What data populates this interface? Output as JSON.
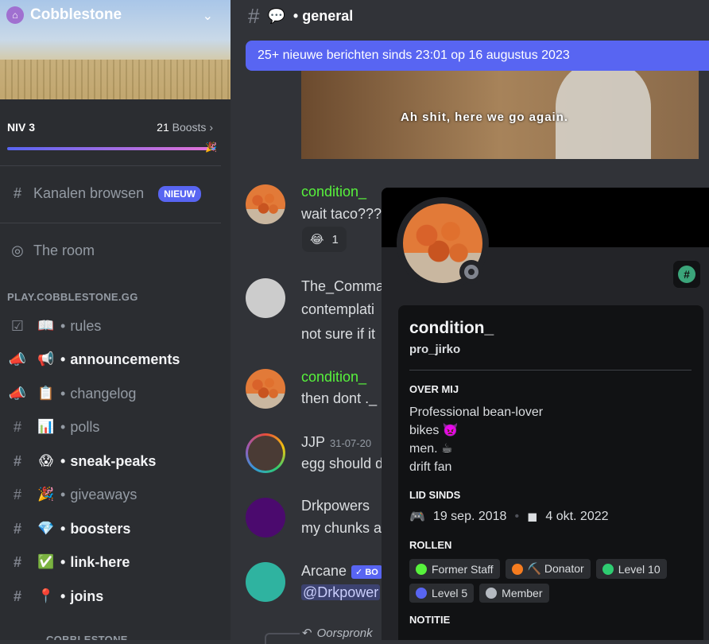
{
  "server": {
    "name": "Cobblestone",
    "level": "NIV 3",
    "boost_count": "21",
    "boost_label": "Boosts",
    "browse_label": "Kanalen browsen",
    "new_badge": "NIEUW",
    "stage": "The room",
    "category": "PLAY.COBBLESTONE.GG",
    "category2": "COBBLESTONE"
  },
  "channels": [
    {
      "icon": "checkbox-icon",
      "emoji": "📖",
      "name": "rules",
      "unread": false
    },
    {
      "icon": "megaphone-icon",
      "emoji": "📢",
      "name": "announcements",
      "unread": true
    },
    {
      "icon": "megaphone-icon",
      "emoji": "📋",
      "name": "changelog",
      "unread": false
    },
    {
      "icon": "hash-icon",
      "emoji": "📊",
      "name": "polls",
      "unread": false
    },
    {
      "icon": "hash-icon",
      "emoji": "😱",
      "name": "sneak-peaks",
      "unread": true
    },
    {
      "icon": "hash-icon",
      "emoji": "🎉",
      "name": "giveaways",
      "unread": false
    },
    {
      "icon": "hash-icon",
      "emoji": "💎",
      "name": "boosters",
      "unread": true
    },
    {
      "icon": "hash-icon",
      "emoji": "✅",
      "name": "link-here",
      "unread": true
    },
    {
      "icon": "hash-icon",
      "emoji": "📍",
      "name": "joins",
      "unread": true
    }
  ],
  "chat": {
    "channel": "general",
    "new_messages_banner": "25+ nieuwe berichten sinds 23:01 op 16 augustus 2023",
    "video_caption": "Ah shit, here we go again.",
    "messages": [
      {
        "author": "condition_",
        "text": "wait taco???"
      },
      {
        "author": "The_Comma",
        "text": "contemplati",
        "text2": "not sure if it"
      },
      {
        "author": "condition_",
        "text": "then dont ._"
      },
      {
        "author": "JJP",
        "time": "31-07-20",
        "text": "egg should d"
      },
      {
        "author": "Drkpowers",
        "text": "my chunks a"
      },
      {
        "author": "Arcane",
        "tag": "BO",
        "text": "@Drkpower"
      }
    ],
    "reaction_count": "1",
    "reply_label": "Oorspronk"
  },
  "profile": {
    "display_name": "condition_",
    "username": "pro_jirko",
    "about_heading": "OVER MIJ",
    "bio": [
      "Professional bean-lover",
      "bikes 👿",
      "men. ☕",
      "drift fan"
    ],
    "member_since_heading": "LID SINDS",
    "discord_since": "19 sep. 2018",
    "server_since": "4 okt. 2022",
    "roles_heading": "ROLLEN",
    "roles": [
      {
        "name": "Former Staff",
        "color": "#57f23c"
      },
      {
        "name": "⛏️ Donator",
        "color": "#f57c1f"
      },
      {
        "name": "Level 10",
        "color": "#2ecc71"
      },
      {
        "name": "Level 5",
        "color": "#5865f2"
      },
      {
        "name": "Member",
        "color": "#b5bac1"
      }
    ],
    "note_heading": "NOTITIE"
  }
}
